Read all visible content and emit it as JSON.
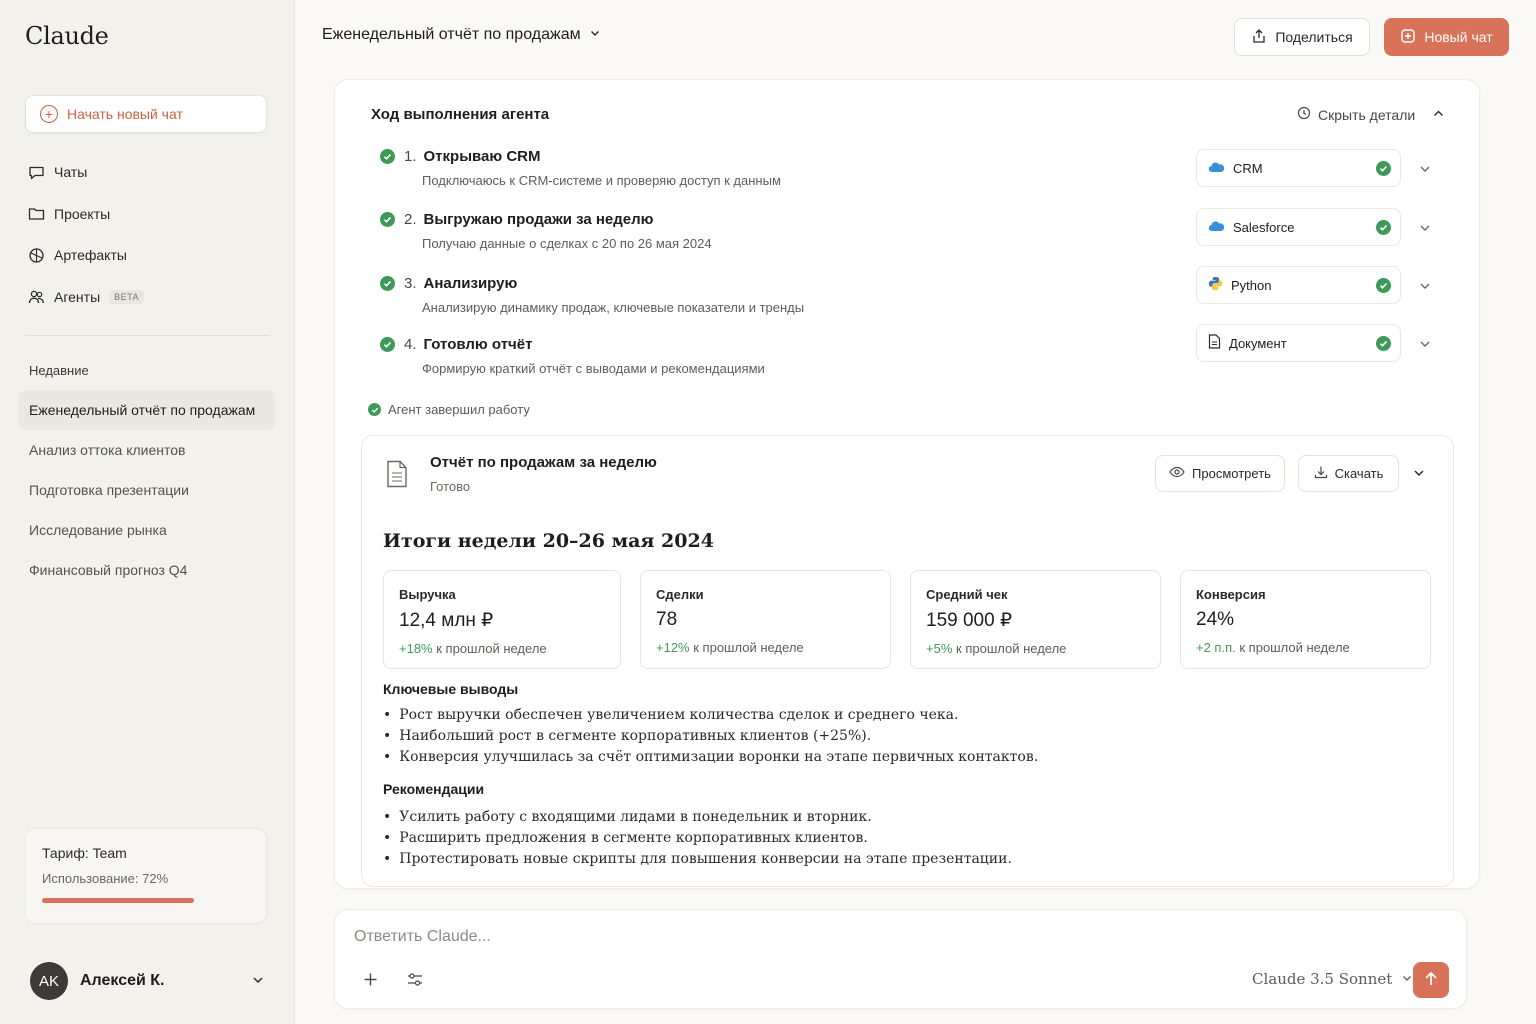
{
  "sidebar": {
    "logo": "Claude",
    "new_chat": "Начать новый чат",
    "nav": [
      {
        "label": "Чаты",
        "icon": "chat-icon"
      },
      {
        "label": "Проекты",
        "icon": "folder-icon"
      },
      {
        "label": "Артефакты",
        "icon": "artifacts-icon"
      },
      {
        "label": "Агенты",
        "icon": "agents-icon",
        "badge": "BETA"
      }
    ],
    "recent_title": "Недавние",
    "recent": [
      "Еженедельный отчёт по продажам",
      "Анализ оттока клиентов",
      "Подготовка презентации",
      "Исследование рынка",
      "Финансовый прогноз Q4"
    ],
    "plan": {
      "title": "Тариф: Team",
      "usage": "Использование: 72%",
      "usage_fraction": 0.72
    },
    "user": {
      "initials": "AK",
      "name": "Алексей К."
    }
  },
  "header": {
    "chat_title": "Еженедельный отчёт по продажам",
    "share": "Поделиться",
    "new_chat": "Новый чат"
  },
  "agent": {
    "title": "Ход выполнения агента",
    "hide_details": "Скрыть детали",
    "steps": [
      {
        "num": "1.",
        "title": "Открываю CRM",
        "desc": "Подключаюсь к CRM-системе и проверяю доступ к данным",
        "tool": "CRM",
        "tool_icon": "cloud-icon"
      },
      {
        "num": "2.",
        "title": "Выгружаю продажи за неделю",
        "desc": "Получаю данные о сделках с 20 по 26 мая 2024",
        "tool": "Salesforce",
        "tool_icon": "cloud-icon"
      },
      {
        "num": "3.",
        "title": "Анализирую",
        "desc": "Анализирую динамику продаж, ключевые показатели и тренды",
        "tool": "Python",
        "tool_icon": "python-icon"
      },
      {
        "num": "4.",
        "title": "Готовлю отчёт",
        "desc": "Формирую краткий отчёт с выводами и рекомендациями",
        "tool": "Документ",
        "tool_icon": "document-icon"
      }
    ],
    "done": "Агент завершил работу"
  },
  "report": {
    "title": "Отчёт по продажам за неделю",
    "status": "Готово",
    "view": "Просмотреть",
    "download": "Скачать",
    "heading": "Итоги недели 20–26 мая 2024",
    "metrics": [
      {
        "label": "Выручка",
        "value": "12,4 млн ₽",
        "delta": "+18%",
        "suffix": "к прошлой неделе"
      },
      {
        "label": "Сделки",
        "value": "78",
        "delta": "+12%",
        "suffix": "к прошлой неделе"
      },
      {
        "label": "Средний чек",
        "value": "159 000 ₽",
        "delta": "+5%",
        "suffix": "к прошлой неделе"
      },
      {
        "label": "Конверсия",
        "value": "24%",
        "delta": "+2 п.п.",
        "suffix": "к прошлой неделе"
      }
    ],
    "findings_title": "Ключевые выводы",
    "findings": [
      "Рост выручки обеспечен увеличением количества сделок и среднего чека.",
      "Наибольший рост в сегменте корпоративных клиентов (+25%).",
      "Конверсия улучшилась за счёт оптимизации воронки на этапе первичных контактов."
    ],
    "recs_title": "Рекомендации",
    "recs": [
      "Усилить работу с входящими лидами в понедельник и вторник.",
      "Расширить предложения в сегменте корпоративных клиентов.",
      "Протестировать новые скрипты для повышения конверсии на этапе презентации."
    ]
  },
  "composer": {
    "placeholder": "Ответить Claude...",
    "model": "Claude 3.5 Sonnet"
  },
  "colors": {
    "accent": "#d8735a",
    "success": "#3f9a5a",
    "link": "#c96442"
  }
}
